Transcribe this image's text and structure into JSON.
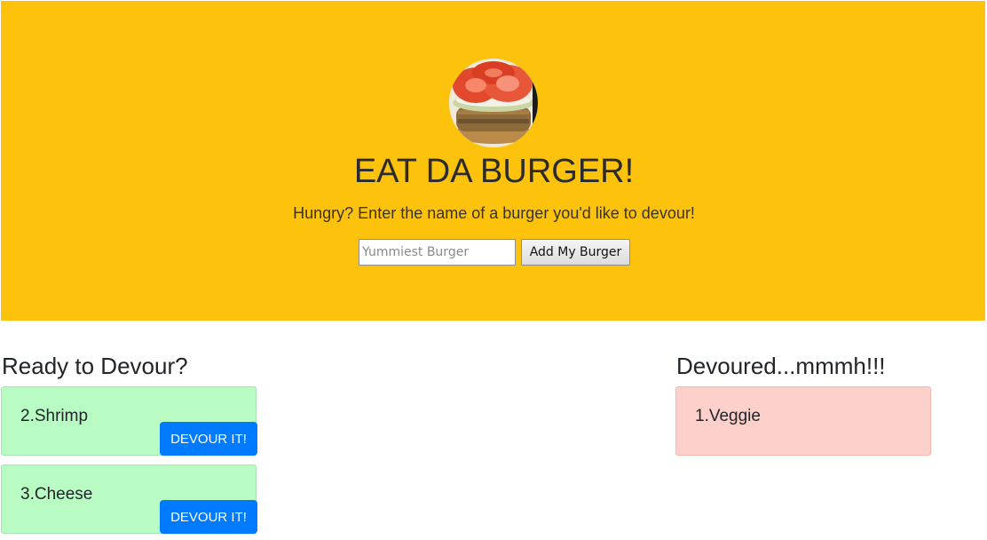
{
  "header": {
    "logo_icon": "burger-photo-icon",
    "title": "EAT DA BURGER!",
    "lead": "Hungry? Enter the name of a burger you'd like to devour!",
    "background_color": "#fdc20b"
  },
  "form": {
    "input_placeholder": "Yummiest Burger",
    "input_value": "",
    "submit_label": "Add My Burger"
  },
  "ready": {
    "heading": "Ready to Devour?",
    "card_color": "#b8fcc4",
    "items": [
      {
        "name": "2.Shrimp",
        "button_label": "DEVOUR IT!"
      },
      {
        "name": "3.Cheese",
        "button_label": "DEVOUR IT!"
      }
    ]
  },
  "devoured": {
    "heading": "Devoured...mmmh!!!",
    "card_color": "#fed0cb",
    "items": [
      {
        "name": "1.Veggie"
      }
    ]
  },
  "accent_button_color": "#007bff"
}
